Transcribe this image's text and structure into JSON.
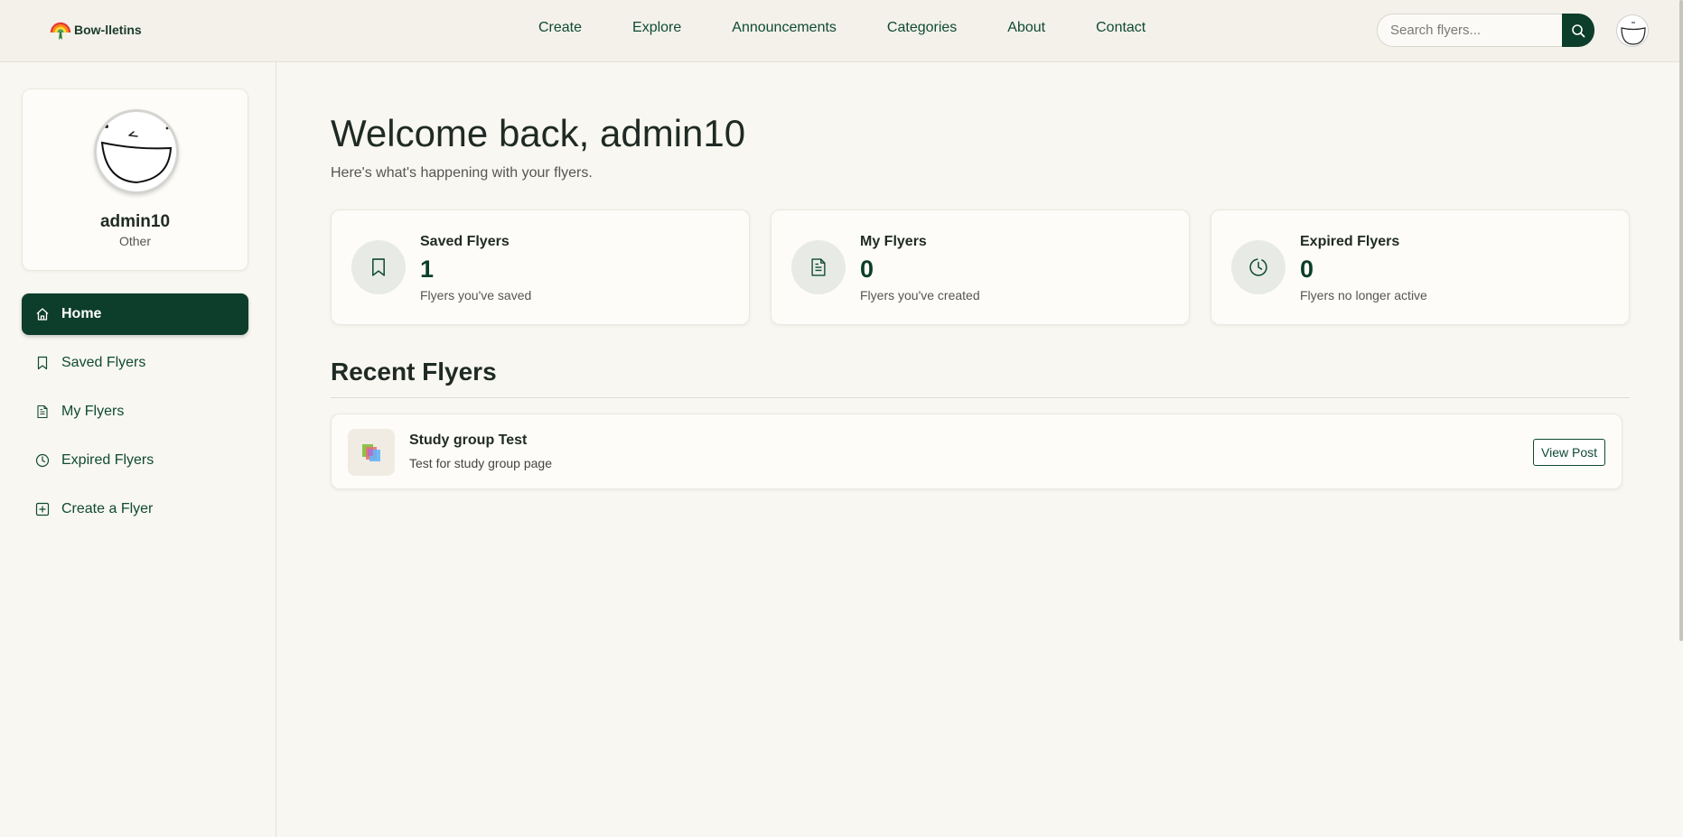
{
  "brand": {
    "name": "Bow-lletins"
  },
  "nav": {
    "items": [
      "Create",
      "Explore",
      "Announcements",
      "Categories",
      "About",
      "Contact"
    ]
  },
  "search": {
    "placeholder": "Search flyers..."
  },
  "profile": {
    "name": "admin10",
    "role": "Other"
  },
  "sidebar": {
    "items": [
      {
        "label": "Home",
        "icon": "home-icon",
        "active": true
      },
      {
        "label": "Saved Flyers",
        "icon": "bookmark-icon",
        "active": false
      },
      {
        "label": "My Flyers",
        "icon": "document-icon",
        "active": false
      },
      {
        "label": "Expired Flyers",
        "icon": "clock-icon",
        "active": false
      },
      {
        "label": "Create a Flyer",
        "icon": "plus-square-icon",
        "active": false
      }
    ]
  },
  "main": {
    "welcome": "Welcome back, admin10",
    "subtitle": "Here's what's happening with your flyers.",
    "stats": [
      {
        "title": "Saved Flyers",
        "value": "1",
        "desc": "Flyers you've saved",
        "icon": "bookmark-icon"
      },
      {
        "title": "My Flyers",
        "value": "0",
        "desc": "Flyers you've created",
        "icon": "document-icon"
      },
      {
        "title": "Expired Flyers",
        "value": "0",
        "desc": "Flyers no longer active",
        "icon": "clock-icon"
      }
    ],
    "recent_title": "Recent Flyers",
    "recent": [
      {
        "title": "Study group Test",
        "desc": "Test for study group page",
        "action": "View Post"
      }
    ]
  },
  "colors": {
    "primary": "#0d3d2b",
    "background": "#f9f7f1",
    "card": "#fdfcf8"
  }
}
